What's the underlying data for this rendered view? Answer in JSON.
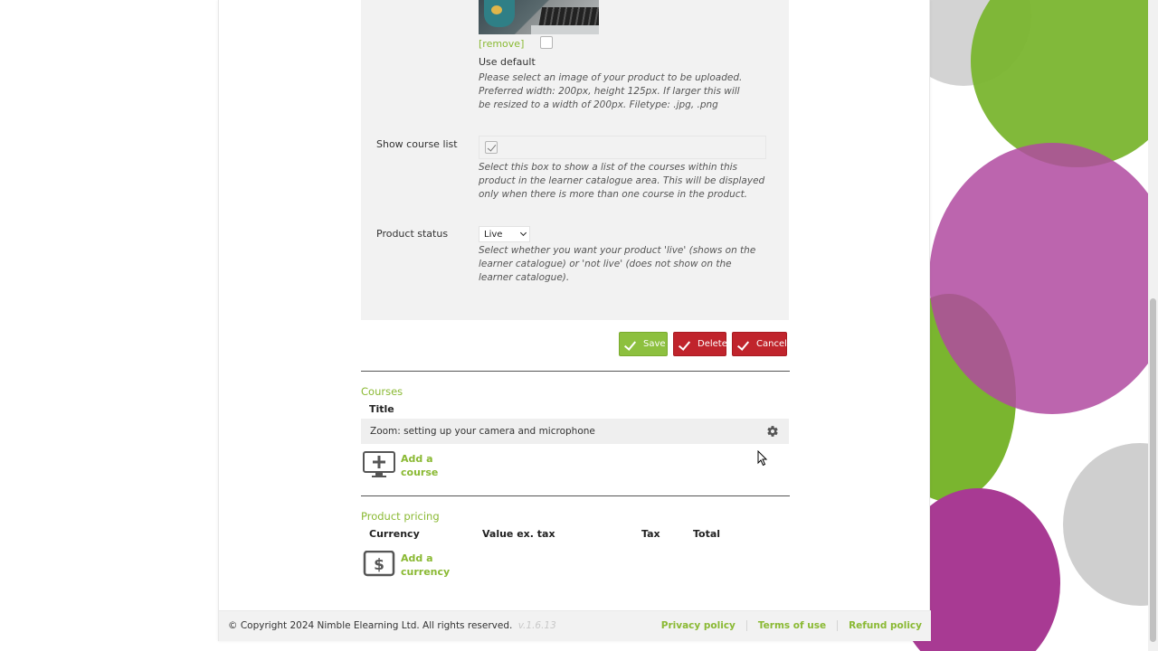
{
  "image_upload": {
    "remove_label": "[remove]",
    "use_default_label": "Use default",
    "hint": "Please select an image of your product to be uploaded. Preferred width: 200px, height 125px. If larger this will be resized to a width of 200px. Filetype: .jpg, .png",
    "use_default_checked": false
  },
  "show_course_list": {
    "label": "Show course list",
    "checked": true,
    "hint": "Select this box to show a list of the courses within this product in the learner catalogue area. This will be displayed only when there is more than one course in the product."
  },
  "product_status": {
    "label": "Product status",
    "selected": "Live",
    "hint": "Select whether you want your product 'live' (shows on the learner catalogue) or 'not live' (does not show on the learner catalogue)."
  },
  "actions": {
    "save": "Save",
    "delete": "Delete",
    "cancel": "Cancel"
  },
  "courses": {
    "section_title": "Courses",
    "col_title": "Title",
    "items": [
      "Zoom: setting up your camera and microphone"
    ],
    "add_label_line1": "Add a",
    "add_label_line2": "course"
  },
  "pricing": {
    "section_title": "Product pricing",
    "col_currency": "Currency",
    "col_value": "Value ex. tax",
    "col_tax": "Tax",
    "col_total": "Total",
    "add_label_line1": "Add a",
    "add_label_line2": "currency"
  },
  "footer": {
    "copyright": "© Copyright 2024 Nimble Elearning Ltd. All rights reserved.",
    "version": "v.1.6.13",
    "links": [
      "Privacy policy",
      "Terms of use",
      "Refund policy"
    ]
  },
  "colors": {
    "accent_green": "#8ab933",
    "danger_red": "#c0242c",
    "deco_green": "#7ab52f",
    "deco_magenta": "#b04aa0",
    "deco_grey": "#cfcfcf"
  },
  "icons": [
    "gear-icon",
    "add-course-icon",
    "add-currency-icon",
    "check-icon"
  ]
}
